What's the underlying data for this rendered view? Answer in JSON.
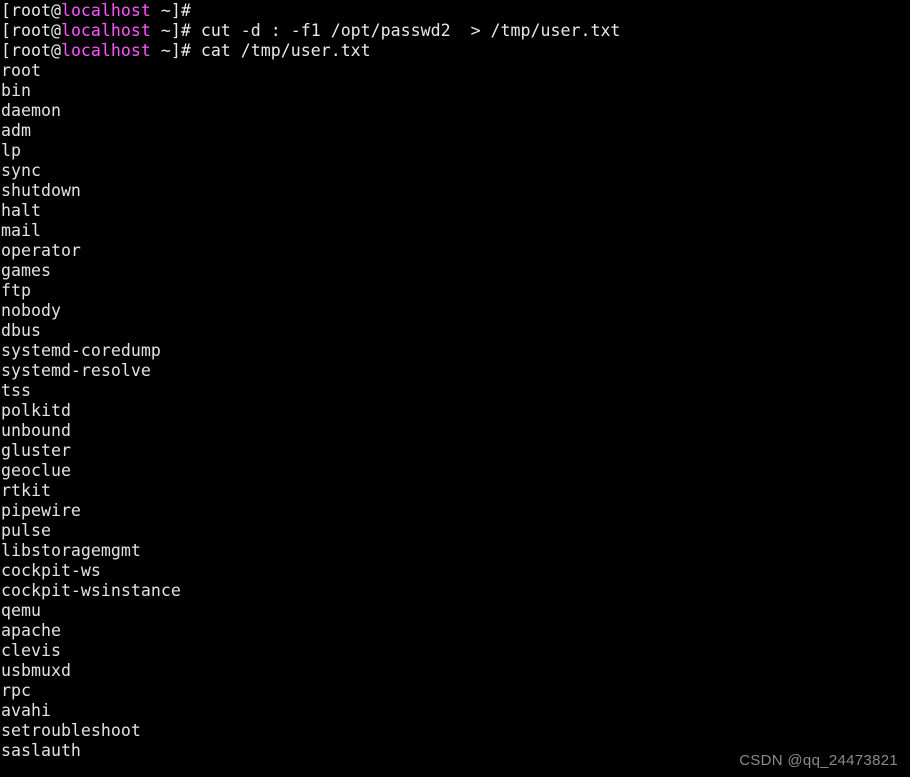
{
  "terminal": {
    "background_color": "#000000",
    "foreground_color": "#d8d8d8",
    "host_color": "#ff55ff",
    "prompt": {
      "user_part": "[root@",
      "host_part": "localhost",
      "tail_part": " ~]# "
    },
    "lines": [
      {
        "type": "prompt",
        "command": ""
      },
      {
        "type": "prompt",
        "command": "cut -d : -f1 /opt/passwd2  > /tmp/user.txt"
      },
      {
        "type": "prompt",
        "command": "cat /tmp/user.txt"
      },
      {
        "type": "output",
        "text": "root"
      },
      {
        "type": "output",
        "text": "bin"
      },
      {
        "type": "output",
        "text": "daemon"
      },
      {
        "type": "output",
        "text": "adm"
      },
      {
        "type": "output",
        "text": "lp"
      },
      {
        "type": "output",
        "text": "sync"
      },
      {
        "type": "output",
        "text": "shutdown"
      },
      {
        "type": "output",
        "text": "halt"
      },
      {
        "type": "output",
        "text": "mail"
      },
      {
        "type": "output",
        "text": "operator"
      },
      {
        "type": "output",
        "text": "games"
      },
      {
        "type": "output",
        "text": "ftp"
      },
      {
        "type": "output",
        "text": "nobody"
      },
      {
        "type": "output",
        "text": "dbus"
      },
      {
        "type": "output",
        "text": "systemd-coredump"
      },
      {
        "type": "output",
        "text": "systemd-resolve"
      },
      {
        "type": "output",
        "text": "tss"
      },
      {
        "type": "output",
        "text": "polkitd"
      },
      {
        "type": "output",
        "text": "unbound"
      },
      {
        "type": "output",
        "text": "gluster"
      },
      {
        "type": "output",
        "text": "geoclue"
      },
      {
        "type": "output",
        "text": "rtkit"
      },
      {
        "type": "output",
        "text": "pipewire"
      },
      {
        "type": "output",
        "text": "pulse"
      },
      {
        "type": "output",
        "text": "libstoragemgmt"
      },
      {
        "type": "output",
        "text": "cockpit-ws"
      },
      {
        "type": "output",
        "text": "cockpit-wsinstance"
      },
      {
        "type": "output",
        "text": "qemu"
      },
      {
        "type": "output",
        "text": "apache"
      },
      {
        "type": "output",
        "text": "clevis"
      },
      {
        "type": "output",
        "text": "usbmuxd"
      },
      {
        "type": "output",
        "text": "rpc"
      },
      {
        "type": "output",
        "text": "avahi"
      },
      {
        "type": "output",
        "text": "setroubleshoot"
      },
      {
        "type": "output",
        "text": "saslauth"
      }
    ]
  },
  "watermark": {
    "text": "CSDN @qq_24473821"
  }
}
